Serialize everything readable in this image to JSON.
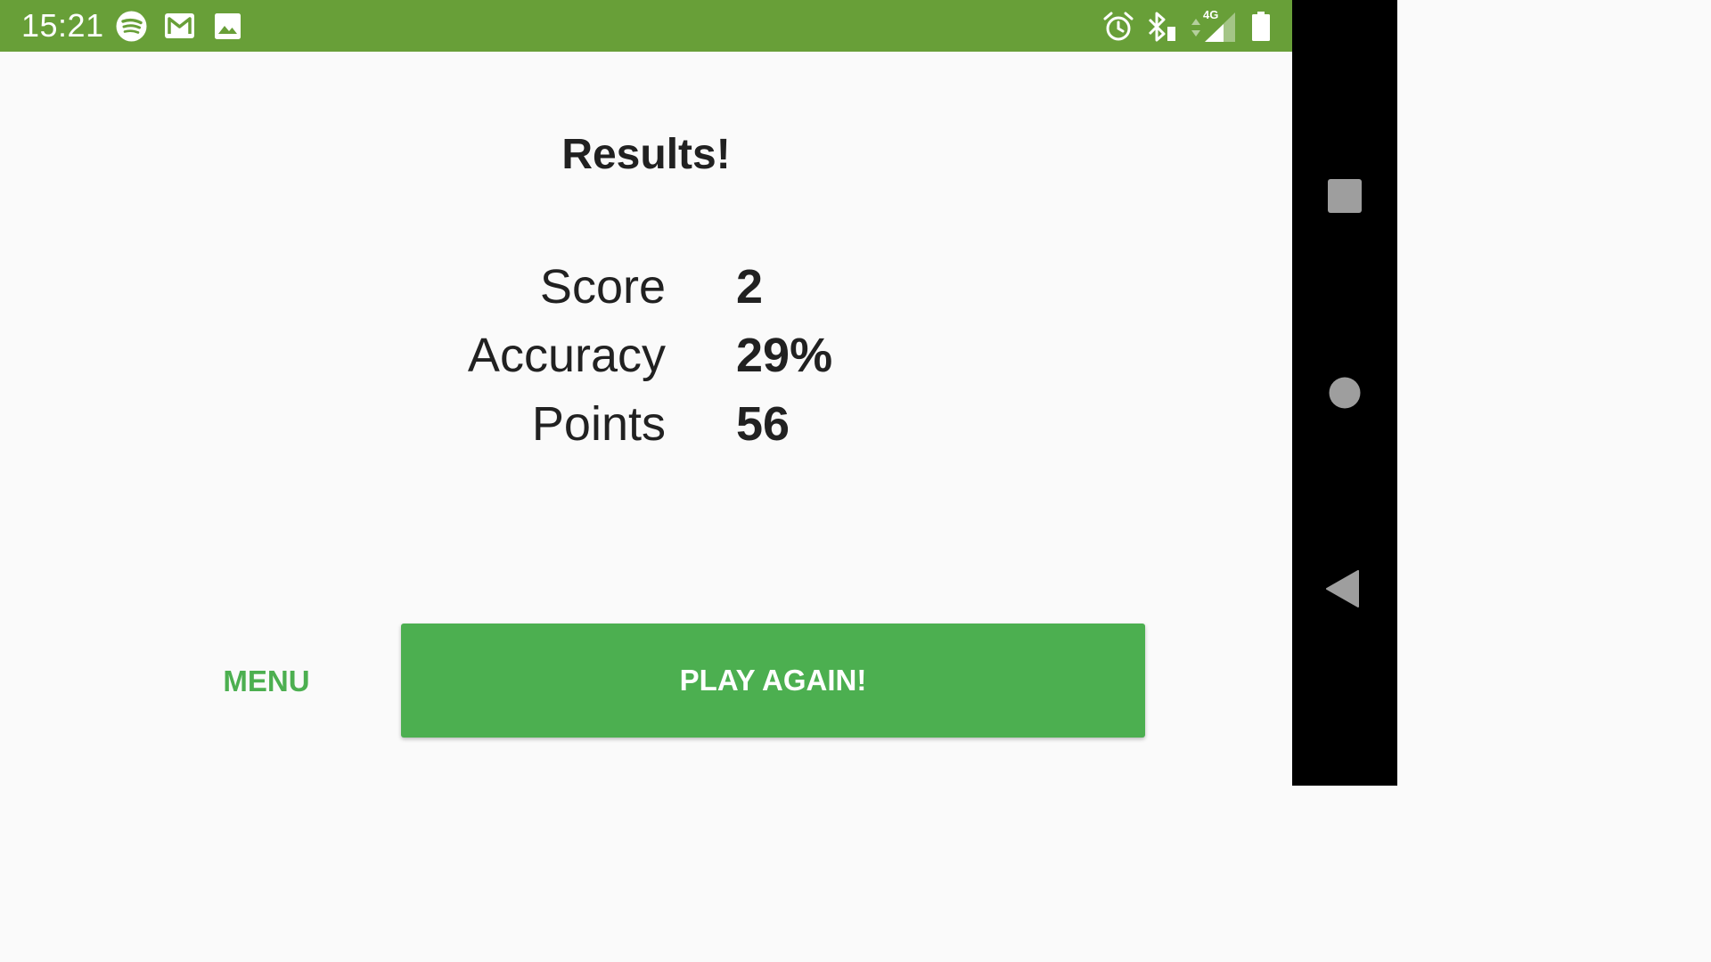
{
  "status_bar": {
    "time": "15:21",
    "network_label": "4G",
    "background": "#689f38",
    "left_icons": [
      "spotify-icon",
      "gmail-icon",
      "gallery-icon"
    ],
    "right_icons": [
      "alarm-icon",
      "bluetooth-icon",
      "data-arrows-icon",
      "signal-icon",
      "battery-icon"
    ]
  },
  "results": {
    "title": "Results!",
    "score_label": "Score",
    "score_value": "2",
    "accuracy_label": "Accuracy",
    "accuracy_value": "29%",
    "points_label": "Points",
    "points_value": "56"
  },
  "actions": {
    "menu_label": "MENU",
    "play_again_label": "PLAY AGAIN!",
    "accent": "#4caf50"
  },
  "nav_bar": {
    "icons": [
      "recents-icon",
      "home-icon",
      "back-icon"
    ]
  }
}
